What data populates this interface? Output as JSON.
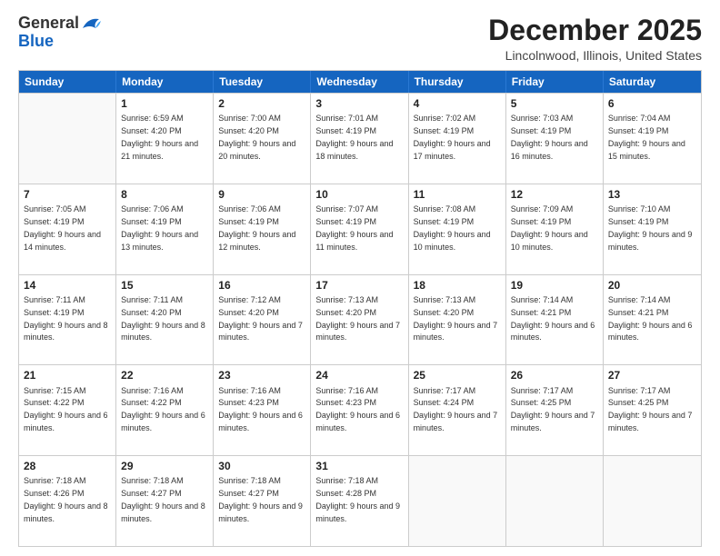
{
  "logo": {
    "general": "General",
    "blue": "Blue"
  },
  "title": "December 2025",
  "location": "Lincolnwood, Illinois, United States",
  "days": [
    "Sunday",
    "Monday",
    "Tuesday",
    "Wednesday",
    "Thursday",
    "Friday",
    "Saturday"
  ],
  "weeks": [
    [
      {
        "day": "",
        "sunrise": "",
        "sunset": "",
        "daylight": ""
      },
      {
        "day": "1",
        "sunrise": "Sunrise: 6:59 AM",
        "sunset": "Sunset: 4:20 PM",
        "daylight": "Daylight: 9 hours and 21 minutes."
      },
      {
        "day": "2",
        "sunrise": "Sunrise: 7:00 AM",
        "sunset": "Sunset: 4:20 PM",
        "daylight": "Daylight: 9 hours and 20 minutes."
      },
      {
        "day": "3",
        "sunrise": "Sunrise: 7:01 AM",
        "sunset": "Sunset: 4:19 PM",
        "daylight": "Daylight: 9 hours and 18 minutes."
      },
      {
        "day": "4",
        "sunrise": "Sunrise: 7:02 AM",
        "sunset": "Sunset: 4:19 PM",
        "daylight": "Daylight: 9 hours and 17 minutes."
      },
      {
        "day": "5",
        "sunrise": "Sunrise: 7:03 AM",
        "sunset": "Sunset: 4:19 PM",
        "daylight": "Daylight: 9 hours and 16 minutes."
      },
      {
        "day": "6",
        "sunrise": "Sunrise: 7:04 AM",
        "sunset": "Sunset: 4:19 PM",
        "daylight": "Daylight: 9 hours and 15 minutes."
      }
    ],
    [
      {
        "day": "7",
        "sunrise": "Sunrise: 7:05 AM",
        "sunset": "Sunset: 4:19 PM",
        "daylight": "Daylight: 9 hours and 14 minutes."
      },
      {
        "day": "8",
        "sunrise": "Sunrise: 7:06 AM",
        "sunset": "Sunset: 4:19 PM",
        "daylight": "Daylight: 9 hours and 13 minutes."
      },
      {
        "day": "9",
        "sunrise": "Sunrise: 7:06 AM",
        "sunset": "Sunset: 4:19 PM",
        "daylight": "Daylight: 9 hours and 12 minutes."
      },
      {
        "day": "10",
        "sunrise": "Sunrise: 7:07 AM",
        "sunset": "Sunset: 4:19 PM",
        "daylight": "Daylight: 9 hours and 11 minutes."
      },
      {
        "day": "11",
        "sunrise": "Sunrise: 7:08 AM",
        "sunset": "Sunset: 4:19 PM",
        "daylight": "Daylight: 9 hours and 10 minutes."
      },
      {
        "day": "12",
        "sunrise": "Sunrise: 7:09 AM",
        "sunset": "Sunset: 4:19 PM",
        "daylight": "Daylight: 9 hours and 10 minutes."
      },
      {
        "day": "13",
        "sunrise": "Sunrise: 7:10 AM",
        "sunset": "Sunset: 4:19 PM",
        "daylight": "Daylight: 9 hours and 9 minutes."
      }
    ],
    [
      {
        "day": "14",
        "sunrise": "Sunrise: 7:11 AM",
        "sunset": "Sunset: 4:19 PM",
        "daylight": "Daylight: 9 hours and 8 minutes."
      },
      {
        "day": "15",
        "sunrise": "Sunrise: 7:11 AM",
        "sunset": "Sunset: 4:20 PM",
        "daylight": "Daylight: 9 hours and 8 minutes."
      },
      {
        "day": "16",
        "sunrise": "Sunrise: 7:12 AM",
        "sunset": "Sunset: 4:20 PM",
        "daylight": "Daylight: 9 hours and 7 minutes."
      },
      {
        "day": "17",
        "sunrise": "Sunrise: 7:13 AM",
        "sunset": "Sunset: 4:20 PM",
        "daylight": "Daylight: 9 hours and 7 minutes."
      },
      {
        "day": "18",
        "sunrise": "Sunrise: 7:13 AM",
        "sunset": "Sunset: 4:20 PM",
        "daylight": "Daylight: 9 hours and 7 minutes."
      },
      {
        "day": "19",
        "sunrise": "Sunrise: 7:14 AM",
        "sunset": "Sunset: 4:21 PM",
        "daylight": "Daylight: 9 hours and 6 minutes."
      },
      {
        "day": "20",
        "sunrise": "Sunrise: 7:14 AM",
        "sunset": "Sunset: 4:21 PM",
        "daylight": "Daylight: 9 hours and 6 minutes."
      }
    ],
    [
      {
        "day": "21",
        "sunrise": "Sunrise: 7:15 AM",
        "sunset": "Sunset: 4:22 PM",
        "daylight": "Daylight: 9 hours and 6 minutes."
      },
      {
        "day": "22",
        "sunrise": "Sunrise: 7:16 AM",
        "sunset": "Sunset: 4:22 PM",
        "daylight": "Daylight: 9 hours and 6 minutes."
      },
      {
        "day": "23",
        "sunrise": "Sunrise: 7:16 AM",
        "sunset": "Sunset: 4:23 PM",
        "daylight": "Daylight: 9 hours and 6 minutes."
      },
      {
        "day": "24",
        "sunrise": "Sunrise: 7:16 AM",
        "sunset": "Sunset: 4:23 PM",
        "daylight": "Daylight: 9 hours and 6 minutes."
      },
      {
        "day": "25",
        "sunrise": "Sunrise: 7:17 AM",
        "sunset": "Sunset: 4:24 PM",
        "daylight": "Daylight: 9 hours and 7 minutes."
      },
      {
        "day": "26",
        "sunrise": "Sunrise: 7:17 AM",
        "sunset": "Sunset: 4:25 PM",
        "daylight": "Daylight: 9 hours and 7 minutes."
      },
      {
        "day": "27",
        "sunrise": "Sunrise: 7:17 AM",
        "sunset": "Sunset: 4:25 PM",
        "daylight": "Daylight: 9 hours and 7 minutes."
      }
    ],
    [
      {
        "day": "28",
        "sunrise": "Sunrise: 7:18 AM",
        "sunset": "Sunset: 4:26 PM",
        "daylight": "Daylight: 9 hours and 8 minutes."
      },
      {
        "day": "29",
        "sunrise": "Sunrise: 7:18 AM",
        "sunset": "Sunset: 4:27 PM",
        "daylight": "Daylight: 9 hours and 8 minutes."
      },
      {
        "day": "30",
        "sunrise": "Sunrise: 7:18 AM",
        "sunset": "Sunset: 4:27 PM",
        "daylight": "Daylight: 9 hours and 9 minutes."
      },
      {
        "day": "31",
        "sunrise": "Sunrise: 7:18 AM",
        "sunset": "Sunset: 4:28 PM",
        "daylight": "Daylight: 9 hours and 9 minutes."
      },
      {
        "day": "",
        "sunrise": "",
        "sunset": "",
        "daylight": ""
      },
      {
        "day": "",
        "sunrise": "",
        "sunset": "",
        "daylight": ""
      },
      {
        "day": "",
        "sunrise": "",
        "sunset": "",
        "daylight": ""
      }
    ]
  ]
}
